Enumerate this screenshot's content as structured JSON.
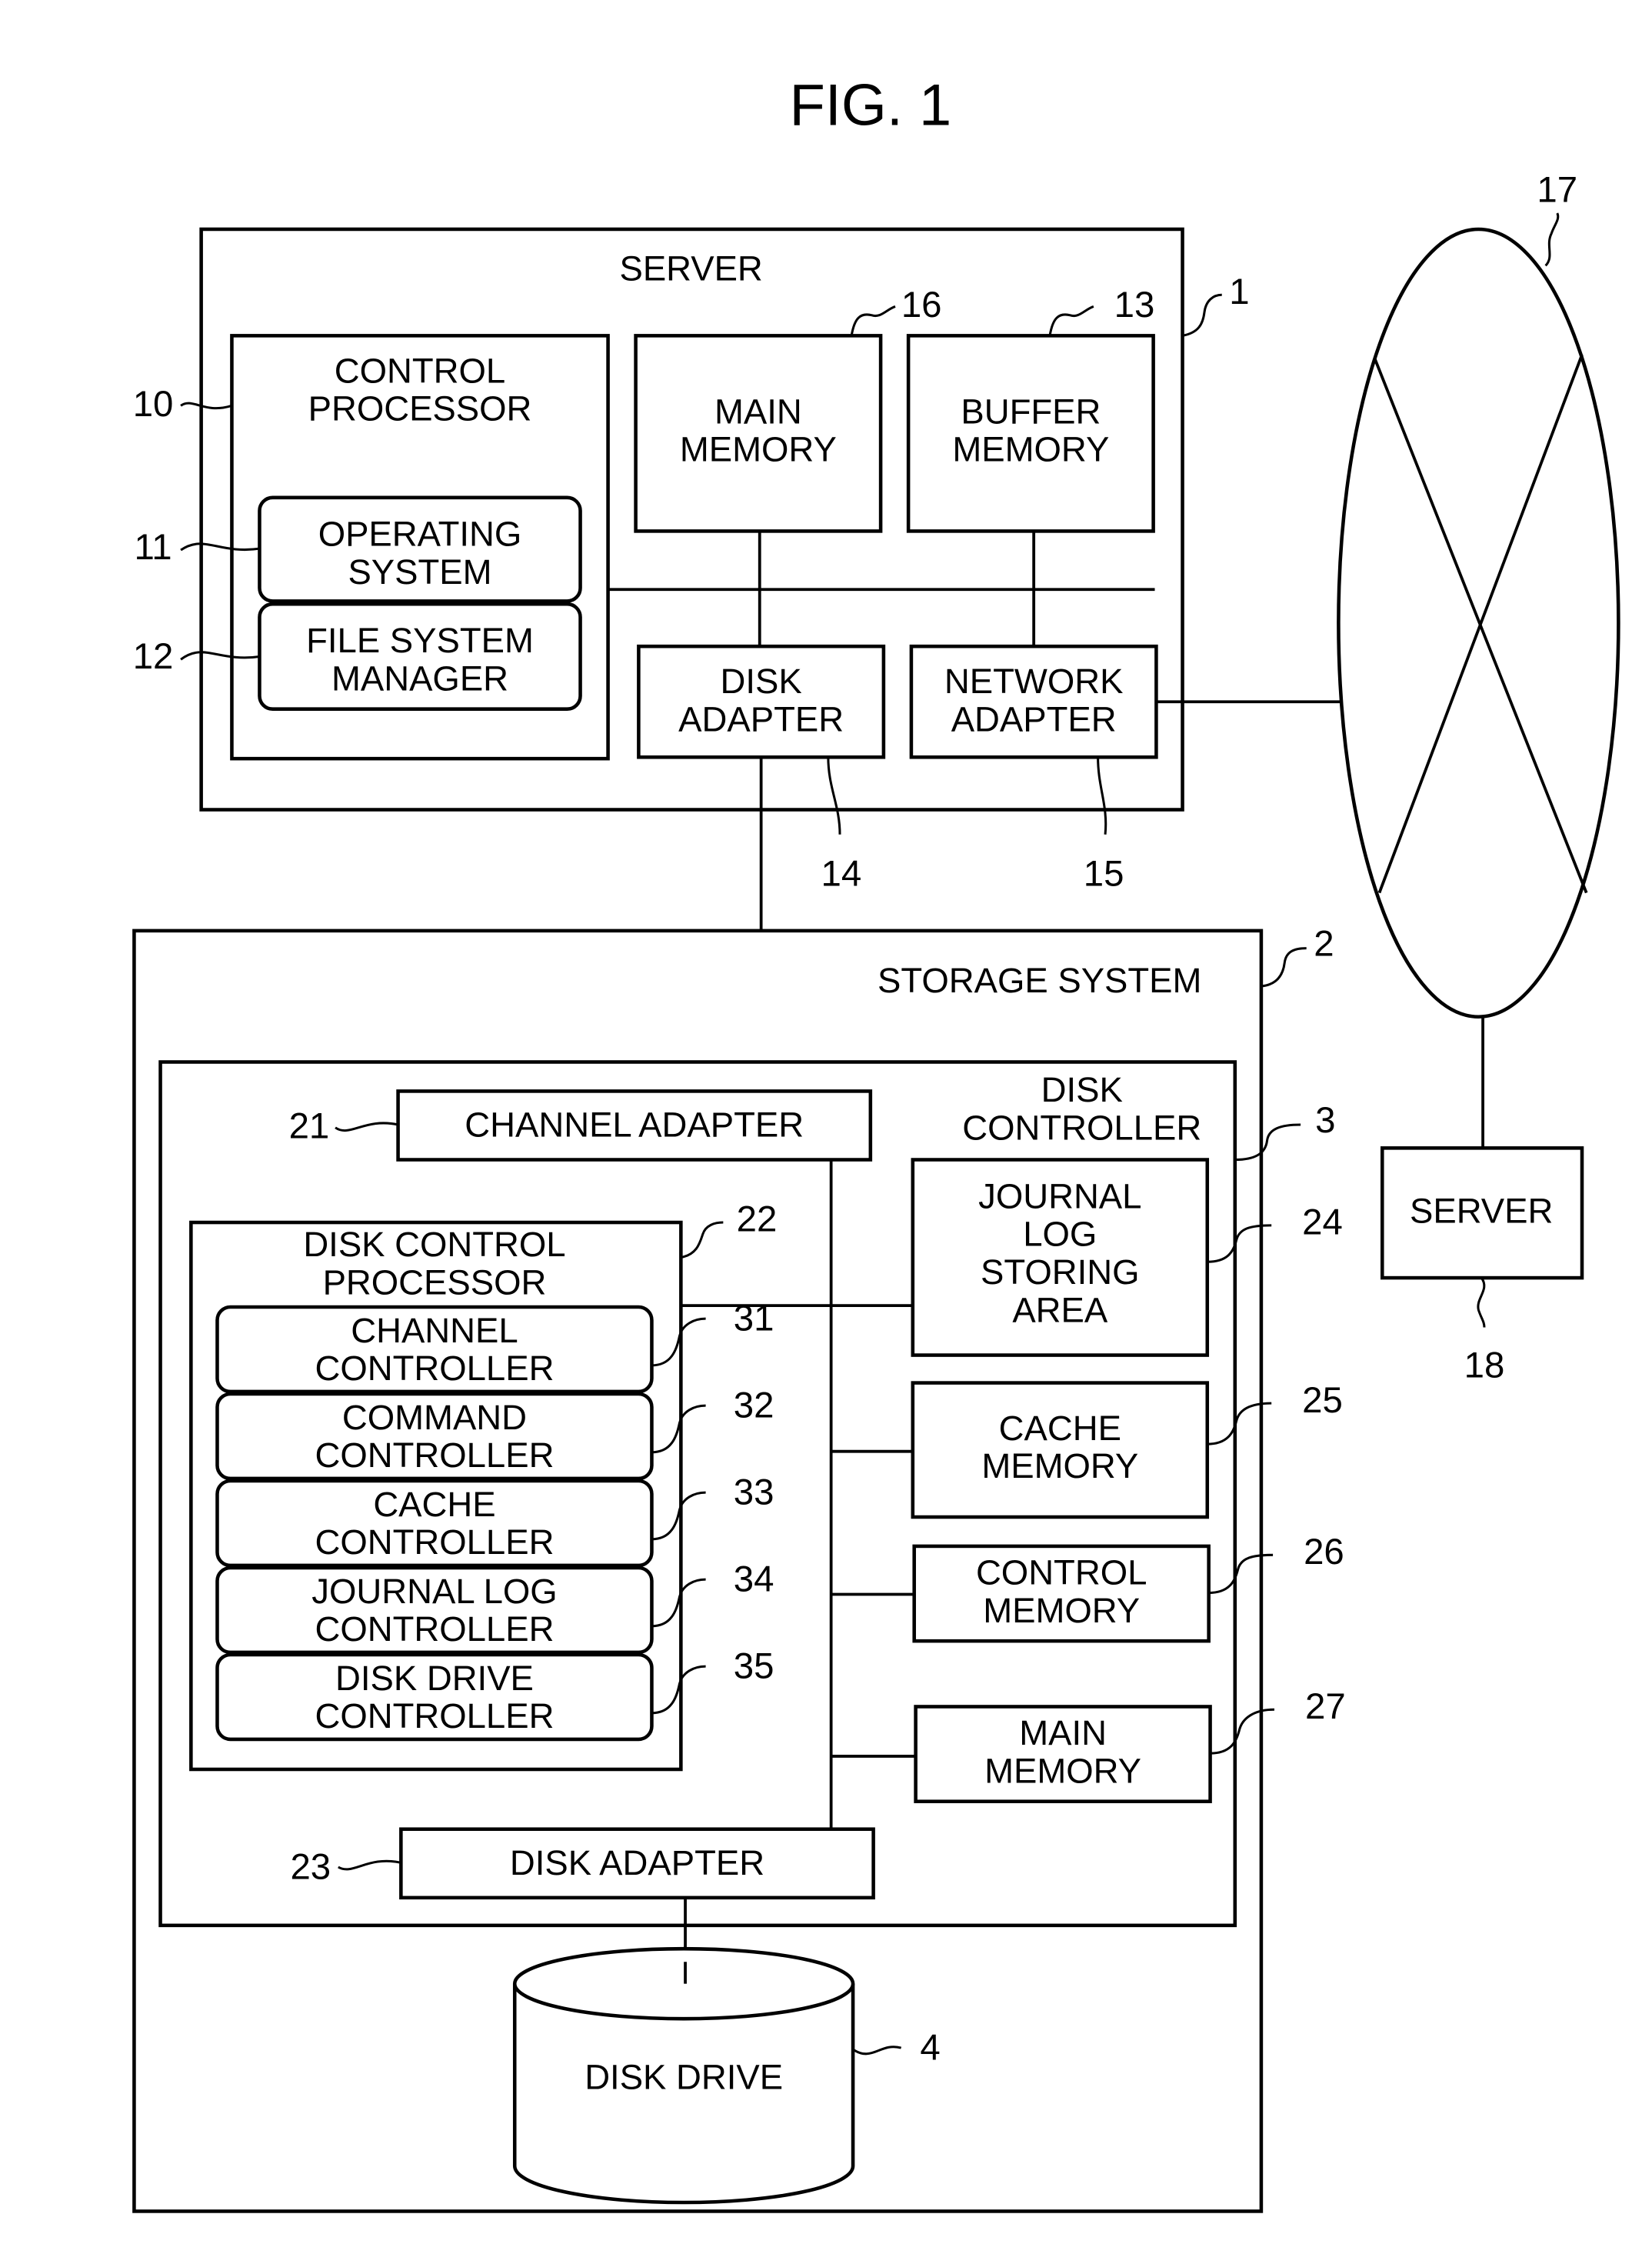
{
  "figure": {
    "title": "FIG. 1"
  },
  "server": {
    "label": "SERVER",
    "ref": "1",
    "control_processor": {
      "line1": "CONTROL",
      "line2": "PROCESSOR",
      "ref": "10"
    },
    "operating_system": {
      "line1": "OPERATING",
      "line2": "SYSTEM",
      "ref": "11"
    },
    "file_system_manager": {
      "line1": "FILE SYSTEM",
      "line2": "MANAGER",
      "ref": "12"
    },
    "buffer_memory": {
      "line1": "BUFFER",
      "line2": "MEMORY",
      "ref": "13"
    },
    "disk_adapter": {
      "line1": "DISK",
      "line2": "ADAPTER",
      "ref": "14"
    },
    "network_adapter": {
      "line1": "NETWORK",
      "line2": "ADAPTER",
      "ref": "15"
    },
    "main_memory": {
      "line1": "MAIN",
      "line2": "MEMORY",
      "ref": "16"
    }
  },
  "network": {
    "ref": "17"
  },
  "remote_server": {
    "label": "SERVER",
    "ref": "18"
  },
  "storage_system": {
    "label": "STORAGE SYSTEM",
    "ref": "2",
    "disk_controller": {
      "line1": "DISK",
      "line2": "CONTROLLER",
      "ref": "3",
      "channel_adapter": {
        "label": "CHANNEL ADAPTER",
        "ref": "21"
      },
      "disk_control_processor": {
        "line1": "DISK CONTROL",
        "line2": "PROCESSOR",
        "ref": "22",
        "modules": [
          {
            "line1": "CHANNEL",
            "line2": "CONTROLLER",
            "ref": "31"
          },
          {
            "line1": "COMMAND",
            "line2": "CONTROLLER",
            "ref": "32"
          },
          {
            "line1": "CACHE",
            "line2": "CONTROLLER",
            "ref": "33"
          },
          {
            "line1": "JOURNAL LOG",
            "line2": "CONTROLLER",
            "ref": "34"
          },
          {
            "line1": "DISK DRIVE",
            "line2": "CONTROLLER",
            "ref": "35"
          }
        ]
      },
      "disk_adapter": {
        "label": "DISK ADAPTER",
        "ref": "23"
      },
      "journal_log_storing_area": {
        "line1": "JOURNAL",
        "line2": "LOG",
        "line3": "STORING",
        "line4": "AREA",
        "ref": "24"
      },
      "cache_memory": {
        "line1": "CACHE",
        "line2": "MEMORY",
        "ref": "25"
      },
      "control_memory": {
        "line1": "CONTROL",
        "line2": "MEMORY",
        "ref": "26"
      },
      "main_memory": {
        "line1": "MAIN",
        "line2": "MEMORY",
        "ref": "27"
      }
    },
    "disk_drive": {
      "label": "DISK DRIVE",
      "ref": "4"
    }
  }
}
